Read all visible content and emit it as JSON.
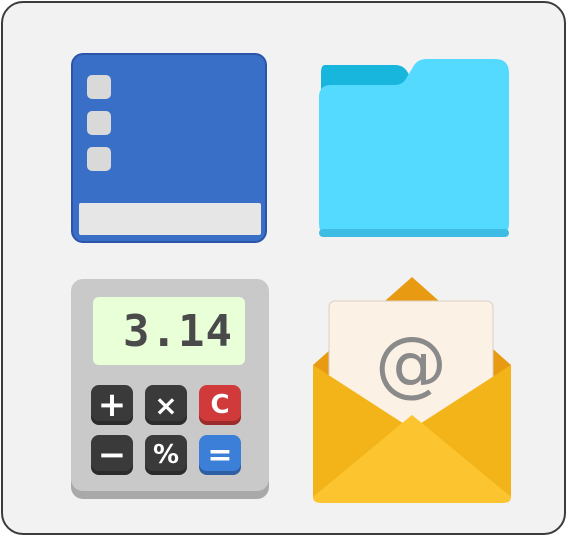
{
  "tiles": [
    {
      "id": "book",
      "icon": "book-icon"
    },
    {
      "id": "folder",
      "icon": "folder-icon"
    },
    {
      "id": "calculator",
      "icon": "calculator-icon"
    },
    {
      "id": "mail",
      "icon": "mail-icon"
    }
  ],
  "calculator": {
    "display": "3.14",
    "keys": {
      "plus": "+",
      "times": "×",
      "clear": "C",
      "minus": "−",
      "percent": "%",
      "equals": "="
    }
  },
  "mail": {
    "symbol": "@"
  },
  "colors": {
    "panel_bg": "#f2f2f2",
    "panel_border": "#3c3c3c",
    "book_blue": "#3a6fc8",
    "folder_cyan": "#55daff",
    "folder_tab": "#18b6dc",
    "calc_body": "#c9c9c9",
    "calc_display": "#e8ffd8",
    "mail_yellow": "#f7c22c",
    "mail_flap": "#e89a12"
  }
}
